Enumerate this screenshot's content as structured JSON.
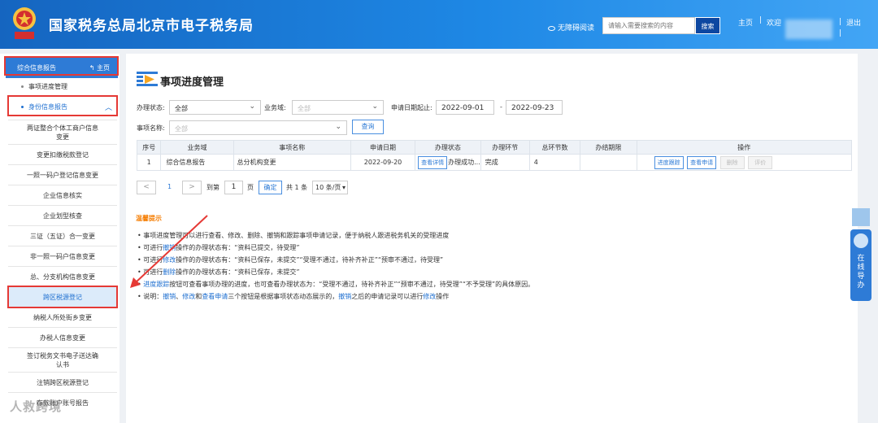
{
  "header": {
    "title": "国家税务总局北京市电子税务局",
    "emblem_text": "税务",
    "access_mode": "无障碍阅读",
    "search_placeholder": "请输入需要搜索的内容",
    "search_button": "搜索",
    "home": "主页",
    "sep": "|",
    "welcome": "欢迎",
    "logout": "退出"
  },
  "sidebar": {
    "head_label": "综合信息报告",
    "head_home": "主页",
    "items": [
      {
        "label": "事项进度管理"
      },
      {
        "label": "身份信息报告"
      }
    ],
    "sub_items": [
      "两证整合个体工商户信息变更",
      "变更扣缴税款登记",
      "一照一码户登记信息变更",
      "企业信息核实",
      "企业划型核查",
      "三证（五证）合一变更",
      "非一照一码户信息变更",
      "总、分支机构信息变更",
      "跨区税源登记",
      "纳税人所处街乡变更",
      "办税人信息变更",
      "签订税务文书电子送达确认书",
      "注销跨区税源登记",
      "存款账户账号报告"
    ]
  },
  "page": {
    "title": "事项进度管理",
    "filters": {
      "status_label": "办理状态:",
      "status_value": "全部",
      "domain_label": "业务域:",
      "domain_value": "全部",
      "date_label": "申请日期起止:",
      "date_from": "2022-09-01",
      "date_dash": "-",
      "date_to": "2022-09-23",
      "name_label": "事项名称:",
      "name_value": "全部",
      "query_button": "查询"
    },
    "table": {
      "headers": [
        "序号",
        "业务域",
        "事项名称",
        "申请日期",
        "办理状态",
        "办理环节",
        "总环节数",
        "办结期限",
        "操作"
      ],
      "rows": [
        {
          "no": "1",
          "domain": "综合信息报告",
          "name": "总分机构变更",
          "date": "2022-09-20",
          "status_btn": "查看详情",
          "status": "办理成功...",
          "step": "完成",
          "total_steps": "4",
          "deadline": "",
          "actions": [
            "进度跟踪",
            "查看申请",
            "删除",
            "评价"
          ]
        }
      ]
    },
    "pager": {
      "prev": "<",
      "current": "1",
      "next": ">",
      "goto": "到第",
      "page_input": "1",
      "page_unit": "页",
      "confirm": "确定",
      "total": "共 1 条",
      "page_size": "10 条/页"
    },
    "tips": {
      "title": "温馨提示",
      "line1": "事项进度管理可以进行查看、修改、删除、撤销和跟踪事项申请记录，便于纳税人跟进税务机关的受理进度",
      "line2_pre": "可进行",
      "line2_b": "撤销",
      "line2_post": "操作的办理状态有：“资料已提交，待受理”",
      "line3_pre": "可进行",
      "line3_b": "修改",
      "line3_post": "操作的办理状态有：“资料已保存，未提交”“受理不通过，待补齐补正”“预审不通过，待受理”",
      "line4_pre": "可进行",
      "line4_b": "删除",
      "line4_post": "操作的办理状态有：“资料已保存，未提交”",
      "line5_b": "进度跟踪",
      "line5_post": "按钮可查看事项办理的进度，也可查看办理状态为：“受理不通过，待补齐补正”“预审不通过，待受理”“不予受理”的具体原因。",
      "line6_a": "说明：",
      "line6_b1": "撤销",
      "line6_s1": "、",
      "line6_b2": "修改",
      "line6_s2": "和",
      "line6_b3": "查看申请",
      "line6_mid": "三个按钮是根据事项状态动态展示的，",
      "line6_b4": "撤销",
      "line6_end1": "之后的申请记录可以进行",
      "line6_b5": "修改",
      "line6_end2": "操作"
    }
  },
  "floating": {
    "guide_text": "在线导办"
  },
  "watermark": "人救跨境",
  "colors": {
    "header": "#1e88e5",
    "accent": "#2e7bd6",
    "highlight": "#e53935",
    "tip_title": "#f57c00"
  }
}
